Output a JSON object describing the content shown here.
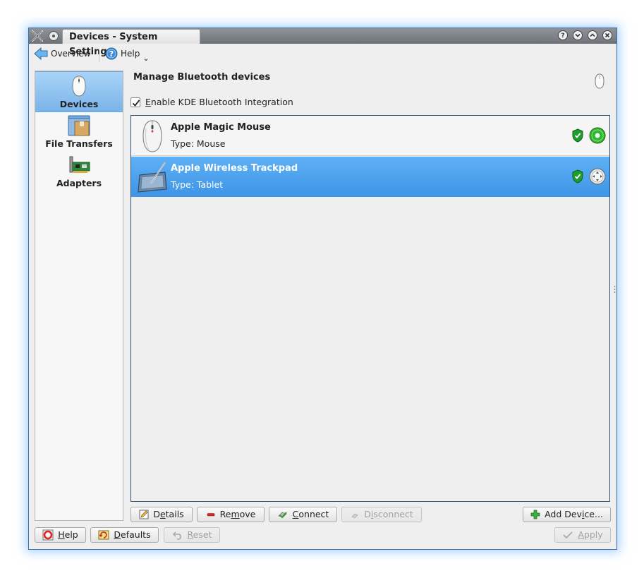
{
  "window": {
    "title": "Devices - System Settings",
    "controls": [
      "?",
      "v",
      "^",
      "x"
    ]
  },
  "toolbar": {
    "overview_label": "Overview",
    "help_label": "Help",
    "help_arrow": "⌄"
  },
  "sidebar": {
    "items": [
      {
        "label": "Devices",
        "icon": "mouse-icon",
        "selected": true
      },
      {
        "label": "File Transfers",
        "icon": "folder-box-icon",
        "selected": false
      },
      {
        "label": "Adapters",
        "icon": "network-card-icon",
        "selected": false
      }
    ]
  },
  "main": {
    "title": "Manage Bluetooth devices",
    "enable_checkbox": {
      "label_accel": "E",
      "label_rest": "nable KDE Bluetooth Integration",
      "checked": true
    },
    "devices": [
      {
        "name": "Apple Magic Mouse",
        "type": "Type: Mouse",
        "trusted": true,
        "connected": true,
        "selected": false
      },
      {
        "name": "Apple Wireless Trackpad",
        "type": "Type: Tablet",
        "trusted": true,
        "connected": false,
        "selected": true
      }
    ]
  },
  "actions": {
    "details": {
      "pre": "D",
      "accel": "e",
      "post": "tails"
    },
    "remove": {
      "pre": "Re",
      "accel": "m",
      "post": "ove"
    },
    "connect": {
      "pre": "",
      "accel": "C",
      "post": "onnect"
    },
    "disconnect": {
      "pre": "D",
      "accel": "i",
      "post": "sconnect"
    },
    "add_device": {
      "pre": "Add Dev",
      "accel": "i",
      "post": "ce..."
    }
  },
  "footer": {
    "help": {
      "pre": "",
      "accel": "H",
      "post": "elp"
    },
    "defaults": {
      "pre": "",
      "accel": "D",
      "post": "efaults"
    },
    "reset": {
      "pre": "",
      "accel": "R",
      "post": "eset"
    },
    "apply": {
      "pre": "",
      "accel": "A",
      "post": "pply"
    }
  },
  "colors": {
    "selection": "#4aa0ec",
    "sidebar_selection": "#8fc4f1",
    "window_glow": "#5aaaff",
    "connected_green": "#2fb52f",
    "shield_green": "#1e9e2e"
  }
}
